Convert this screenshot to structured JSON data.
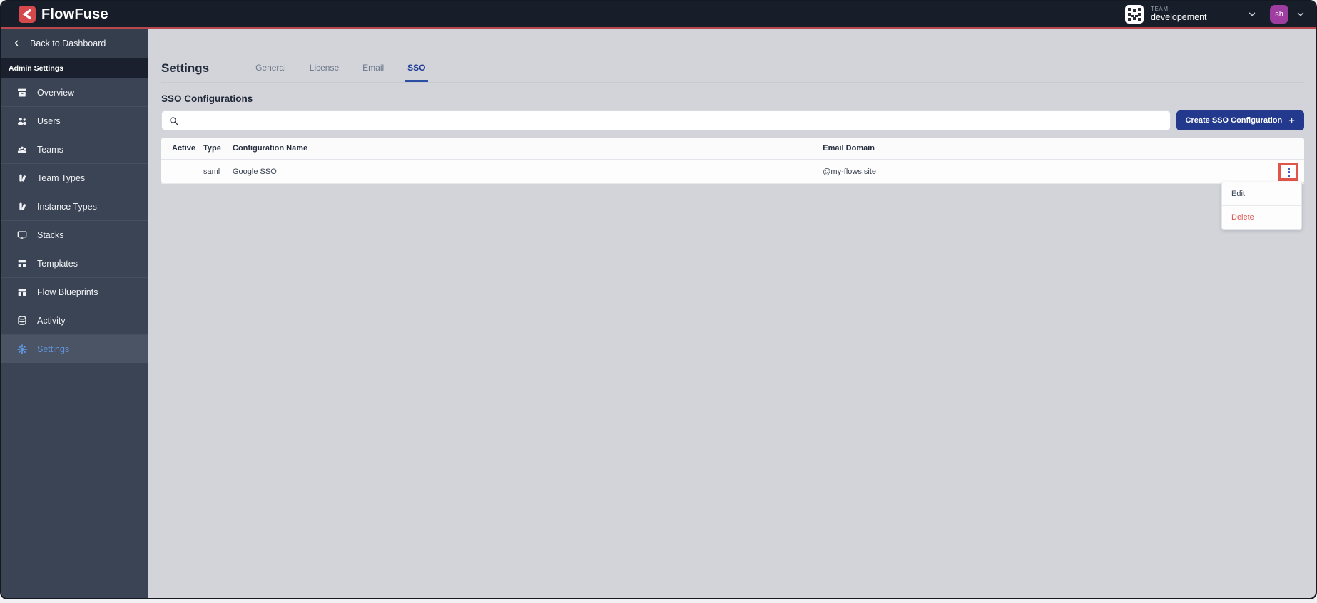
{
  "header": {
    "brand": "FlowFuse",
    "team": {
      "label": "TEAM:",
      "name": "developement"
    },
    "user": {
      "initials": "sh"
    }
  },
  "sidebar": {
    "back_label": "Back to Dashboard",
    "section_label": "Admin Settings",
    "items": [
      {
        "label": "Overview",
        "icon": "overview-icon",
        "active": false
      },
      {
        "label": "Users",
        "icon": "users-icon",
        "active": false
      },
      {
        "label": "Teams",
        "icon": "teams-icon",
        "active": false
      },
      {
        "label": "Team Types",
        "icon": "team-types-icon",
        "active": false
      },
      {
        "label": "Instance Types",
        "icon": "instance-types-icon",
        "active": false
      },
      {
        "label": "Stacks",
        "icon": "stacks-icon",
        "active": false
      },
      {
        "label": "Templates",
        "icon": "templates-icon",
        "active": false
      },
      {
        "label": "Flow Blueprints",
        "icon": "flow-blueprints-icon",
        "active": false
      },
      {
        "label": "Activity",
        "icon": "activity-icon",
        "active": false
      },
      {
        "label": "Settings",
        "icon": "settings-icon",
        "active": true
      }
    ]
  },
  "main": {
    "title": "Settings",
    "tabs": [
      {
        "label": "General",
        "active": false
      },
      {
        "label": "License",
        "active": false
      },
      {
        "label": "Email",
        "active": false
      },
      {
        "label": "SSO",
        "active": true
      }
    ],
    "section_title": "SSO Configurations",
    "search": {
      "value": "",
      "placeholder": ""
    },
    "create_button": {
      "label": "Create SSO Configuration",
      "plus": "+"
    },
    "table": {
      "columns": [
        "Active",
        "Type",
        "Configuration Name",
        "Email Domain"
      ],
      "rows": [
        {
          "active": "",
          "type": "saml",
          "name": "Google SSO",
          "email_domain": "@my-flows.site"
        }
      ]
    },
    "context_menu": {
      "items": [
        {
          "label": "Edit",
          "danger": false
        },
        {
          "label": "Delete",
          "danger": true
        }
      ]
    }
  },
  "colors": {
    "brand_red": "#d5494c",
    "header_accent_line": "#b8484d",
    "link_blue": "#4a8fe2",
    "button_navy": "#22398e",
    "active_tab_blue": "#2d4fa3",
    "sidebar_active_blue": "#6195e0",
    "highlight_box_red": "#e0544a",
    "delete_red": "#df514d",
    "avatar_purple": "#a03da0"
  }
}
